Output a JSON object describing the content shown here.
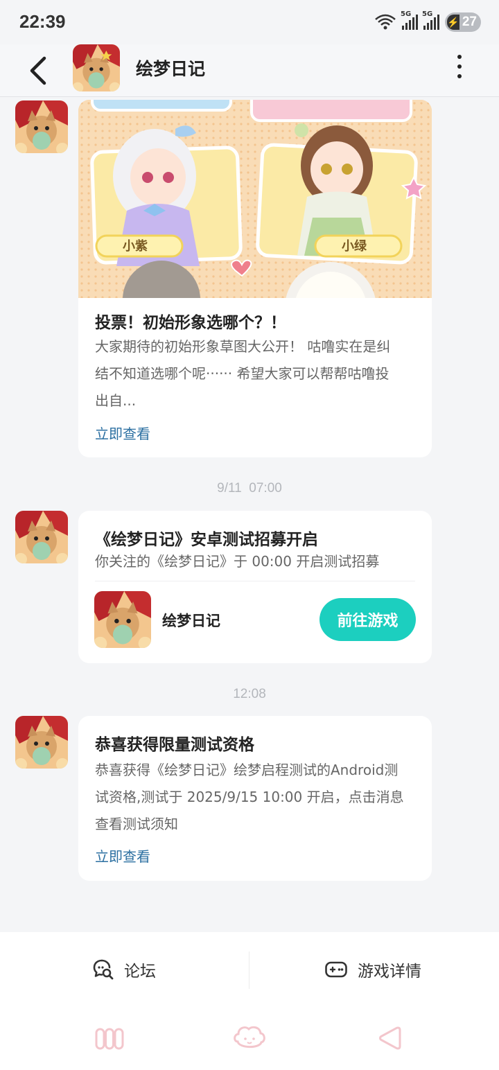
{
  "status_bar": {
    "time": "22:39",
    "network1": "5G",
    "network2": "5G",
    "battery": "27",
    "icons": [
      "wifi-icon",
      "signal-icon",
      "battery-charging-icon"
    ]
  },
  "header": {
    "title": "绘梦日记",
    "back_icon": "chevron-left-icon",
    "more_icon": "more-vertical-icon"
  },
  "messages": [
    {
      "title": "投票！初始形象选哪个？！",
      "body": "大家期待的初始形象草图大公开！ 咕噜实在是纠结不知道选哪个呢······ 希望大家可以帮帮咕噜投出自...",
      "body_lines": [
        "大家期待的初始形象草图大公开！ 咕噜实在是纠",
        "结不知道选哪个呢······ 希望大家可以帮帮咕噜投",
        "出自..."
      ],
      "link": "立即查看",
      "banner_labels": [
        "小紫",
        "小绿"
      ]
    },
    {
      "time": "9/11  07:00",
      "title": "《绘梦日记》安卓测试招募开启",
      "subtitle": "你关注的《绘梦日记》于 00:00 开启测试招募",
      "game_name": "绘梦日记",
      "button": "前往游戏"
    },
    {
      "time": "12:08",
      "title": "恭喜获得限量测试资格",
      "body": "恭喜获得《绘梦日记》绘梦启程测试的Android测试资格,测试于 2025/9/15 10:00 开启，点击消息查看测试须知",
      "body_lines": [
        "恭喜获得《绘梦日记》绘梦启程测试的Android测",
        "试资格,测试于 2025/9/15 10:00 开启，点击消息",
        "查看测试须知"
      ],
      "link": "立即查看"
    }
  ],
  "action_bar": {
    "forum_label": "论坛",
    "forum_icon": "chat-search-icon",
    "details_label": "游戏详情",
    "details_icon": "gamepad-icon"
  },
  "system_nav": {
    "icons": [
      "recent-apps-icon",
      "home-icon",
      "back-icon"
    ],
    "color": "#f3c6cc"
  },
  "colors": {
    "accent": "#1ccfbf",
    "link": "#2b6fa1",
    "background": "#f4f5f7"
  }
}
